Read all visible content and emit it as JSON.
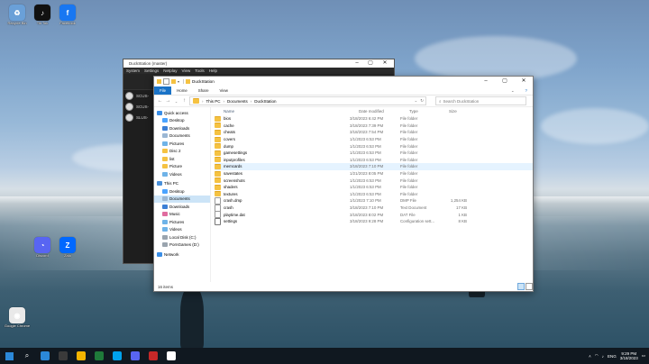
{
  "desktop_icons": [
    {
      "label": "Recycle Bin",
      "color": "#6aa0d8",
      "glyph": "♻"
    },
    {
      "label": "Tik Tok",
      "color": "#111",
      "glyph": "♪"
    },
    {
      "label": "Facebook",
      "color": "#1877f2",
      "glyph": "f"
    },
    {
      "label": "Google Chrome",
      "color": "#e9e9e9",
      "glyph": "◉"
    },
    {
      "label": "Discord",
      "color": "#5865f2",
      "glyph": "◔"
    },
    {
      "label": "Zalo",
      "color": "#0068ff",
      "glyph": "Z"
    }
  ],
  "ds_window": {
    "title": "DuckStation (master)",
    "menu": [
      "System",
      "Settings",
      "Netplay",
      "View",
      "Tools",
      "Help"
    ],
    "rows": [
      "SCUS-",
      "SCUS-",
      "SLUS-"
    ]
  },
  "explorer": {
    "title": "DuckStation",
    "ribbon_tabs": [
      "File",
      "Home",
      "Share",
      "View"
    ],
    "breadcrumb": [
      "This PC",
      "Documents",
      "DuckStation"
    ],
    "search_placeholder": "Search DuckStation",
    "columns": {
      "name": "Name",
      "date": "Date modified",
      "type": "Type",
      "size": "Size"
    },
    "nav": [
      {
        "label": "Quick access",
        "color": "#3a8ee6",
        "selected": false
      },
      {
        "label": "Desktop",
        "color": "#4aa3ff",
        "selected": false
      },
      {
        "label": "Downloads",
        "color": "#3b7fd6",
        "selected": false
      },
      {
        "label": "Documents",
        "color": "#9bb7d4",
        "selected": false
      },
      {
        "label": "Pictures",
        "color": "#6fb3e8",
        "selected": false
      },
      {
        "label": "Disc 2",
        "color": "#f5c242",
        "selected": false
      },
      {
        "label": "list",
        "color": "#f5c242",
        "selected": false
      },
      {
        "label": "Picture",
        "color": "#f5c242",
        "selected": false
      },
      {
        "label": "Videos",
        "color": "#6fb3e8",
        "selected": false
      },
      {
        "label": "This PC",
        "color": "#4a90d9",
        "selected": false
      },
      {
        "label": "Desktop",
        "color": "#4aa3ff",
        "selected": false
      },
      {
        "label": "Documents",
        "color": "#9bb7d4",
        "selected": true
      },
      {
        "label": "Downloads",
        "color": "#3b7fd6",
        "selected": false
      },
      {
        "label": "Music",
        "color": "#e06c9f",
        "selected": false
      },
      {
        "label": "Pictures",
        "color": "#6fb3e8",
        "selected": false
      },
      {
        "label": "Videos",
        "color": "#6fb3e8",
        "selected": false
      },
      {
        "label": "Local Disk (C:)",
        "color": "#9aa4ae",
        "selected": false
      },
      {
        "label": "PornGames (D:)",
        "color": "#9aa4ae",
        "selected": false
      },
      {
        "label": "Network",
        "color": "#3a8ee6",
        "selected": false
      }
    ],
    "files": [
      {
        "name": "bios",
        "date": "3/18/2023 6:42 PM",
        "type": "File folder",
        "size": "",
        "kind": "folder"
      },
      {
        "name": "cache",
        "date": "3/18/2023 7:39 PM",
        "type": "File folder",
        "size": "",
        "kind": "folder"
      },
      {
        "name": "cheats",
        "date": "3/18/2023 7:54 PM",
        "type": "File folder",
        "size": "",
        "kind": "folder"
      },
      {
        "name": "covers",
        "date": "1/1/2023 6:53 PM",
        "type": "File folder",
        "size": "",
        "kind": "folder"
      },
      {
        "name": "dump",
        "date": "1/1/2023 6:53 PM",
        "type": "File folder",
        "size": "",
        "kind": "folder"
      },
      {
        "name": "gamesettings",
        "date": "1/1/2023 6:53 PM",
        "type": "File folder",
        "size": "",
        "kind": "folder"
      },
      {
        "name": "inputprofiles",
        "date": "1/1/2023 6:53 PM",
        "type": "File folder",
        "size": "",
        "kind": "folder"
      },
      {
        "name": "memcards",
        "date": "3/18/2023 7:10 PM",
        "type": "File folder",
        "size": "",
        "kind": "folder"
      },
      {
        "name": "savestates",
        "date": "1/21/2023 8:05 PM",
        "type": "File folder",
        "size": "",
        "kind": "folder"
      },
      {
        "name": "screenshots",
        "date": "1/1/2023 6:53 PM",
        "type": "File folder",
        "size": "",
        "kind": "folder"
      },
      {
        "name": "shaders",
        "date": "1/1/2023 6:53 PM",
        "type": "File folder",
        "size": "",
        "kind": "folder"
      },
      {
        "name": "textures",
        "date": "1/1/2023 6:53 PM",
        "type": "File folder",
        "size": "",
        "kind": "folder"
      },
      {
        "name": "crash.dmp",
        "date": "1/1/2023 7:10 PM",
        "type": "DMP File",
        "size": "1,254 KB",
        "kind": "file"
      },
      {
        "name": "crash",
        "date": "3/18/2023 7:10 PM",
        "type": "Text Document",
        "size": "17 KB",
        "kind": "file"
      },
      {
        "name": "playtime.dat",
        "date": "3/18/2023 8:02 PM",
        "type": "DAT File",
        "size": "1 KB",
        "kind": "file"
      },
      {
        "name": "settings",
        "date": "3/18/2023 9:28 PM",
        "type": "Configuration sett...",
        "size": "8 KB",
        "kind": "gear"
      }
    ],
    "status": "16 items"
  },
  "taskbar": {
    "icons": [
      "#2b88d8",
      "#3a3a3a",
      "#f4b400",
      "#1f7a3a",
      "#00a2ed",
      "#5865f2",
      "#c62828",
      "#ffffff"
    ],
    "lang": "ENG",
    "time": "9:29 PM",
    "date": "3/18/2023"
  }
}
